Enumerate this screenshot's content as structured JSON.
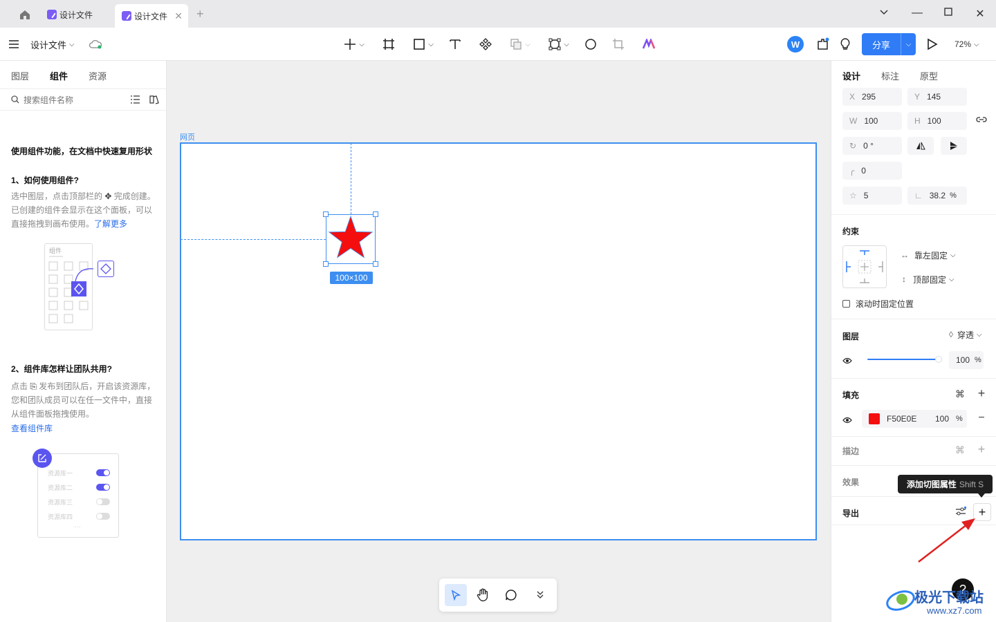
{
  "tabs": [
    {
      "label": "设计文件"
    },
    {
      "label": "设计文件"
    }
  ],
  "toolbar": {
    "file_name": "设计文件",
    "share_label": "分享",
    "zoom": "72%",
    "avatar_letter": "W"
  },
  "left_panel": {
    "tabs": [
      "图层",
      "组件",
      "资源"
    ],
    "search_placeholder": "搜索组件名称",
    "intro_title": "使用组件功能，在文档中快速复用形状",
    "section1_title": "1、如何使用组件?",
    "section1_text_a": "选中图层，点击顶部栏的",
    "section1_text_b": "完成创建。已创建的组件会显示在这个面板，可以直接拖拽到画布使用。",
    "section1_link": "了解更多",
    "illus1_label": "组件",
    "section2_title": "2、组件库怎样让团队共用?",
    "section2_text_a": "点击",
    "section2_text_b": "发布到团队后，开启该资源库，您和团队成员可以在任一文件中，直接从组件面板拖拽使用。",
    "section2_link": "查看组件库",
    "libraries": [
      "资源库一",
      "资源库二",
      "资源库三",
      "资源库四"
    ],
    "library_states": [
      true,
      true,
      false,
      false
    ]
  },
  "canvas": {
    "frame_label": "网页",
    "size_badge": "100×100",
    "star_color": "#F50E0E"
  },
  "bottom_tools": {
    "more": "»"
  },
  "right_panel": {
    "tabs": [
      "设计",
      "标注",
      "原型"
    ],
    "x_key": "X",
    "x": "295",
    "y_key": "Y",
    "y": "145",
    "w_key": "W",
    "w": "100",
    "h_key": "H",
    "h": "100",
    "rotation": "0 °",
    "radius": "0",
    "points": "5",
    "ratio": "38.2",
    "ratio_unit": "%",
    "constraints_title": "约束",
    "constraint_h": "靠左固定",
    "constraint_v": "顶部固定",
    "fixed_scroll_label": "滚动时固定位置",
    "layer_title": "图层",
    "blend": "穿透",
    "opacity": "100",
    "opacity_unit": "%",
    "fill_title": "填充",
    "fill_hex": "F50E0E",
    "fill_opacity": "100",
    "fill_unit": "%",
    "stroke_title": "描边",
    "effect_title": "效果",
    "export_title": "导出",
    "tooltip_label": "添加切图属性",
    "tooltip_shortcut": "Shift S",
    "help": "?"
  },
  "watermark": {
    "text": "极光下载站",
    "url": "www.xz7.com"
  },
  "colors": {
    "accent": "#2a6ee8",
    "share": "#2f7cf6",
    "frame": "#3d8ef0",
    "fill": "#F50E0E"
  }
}
